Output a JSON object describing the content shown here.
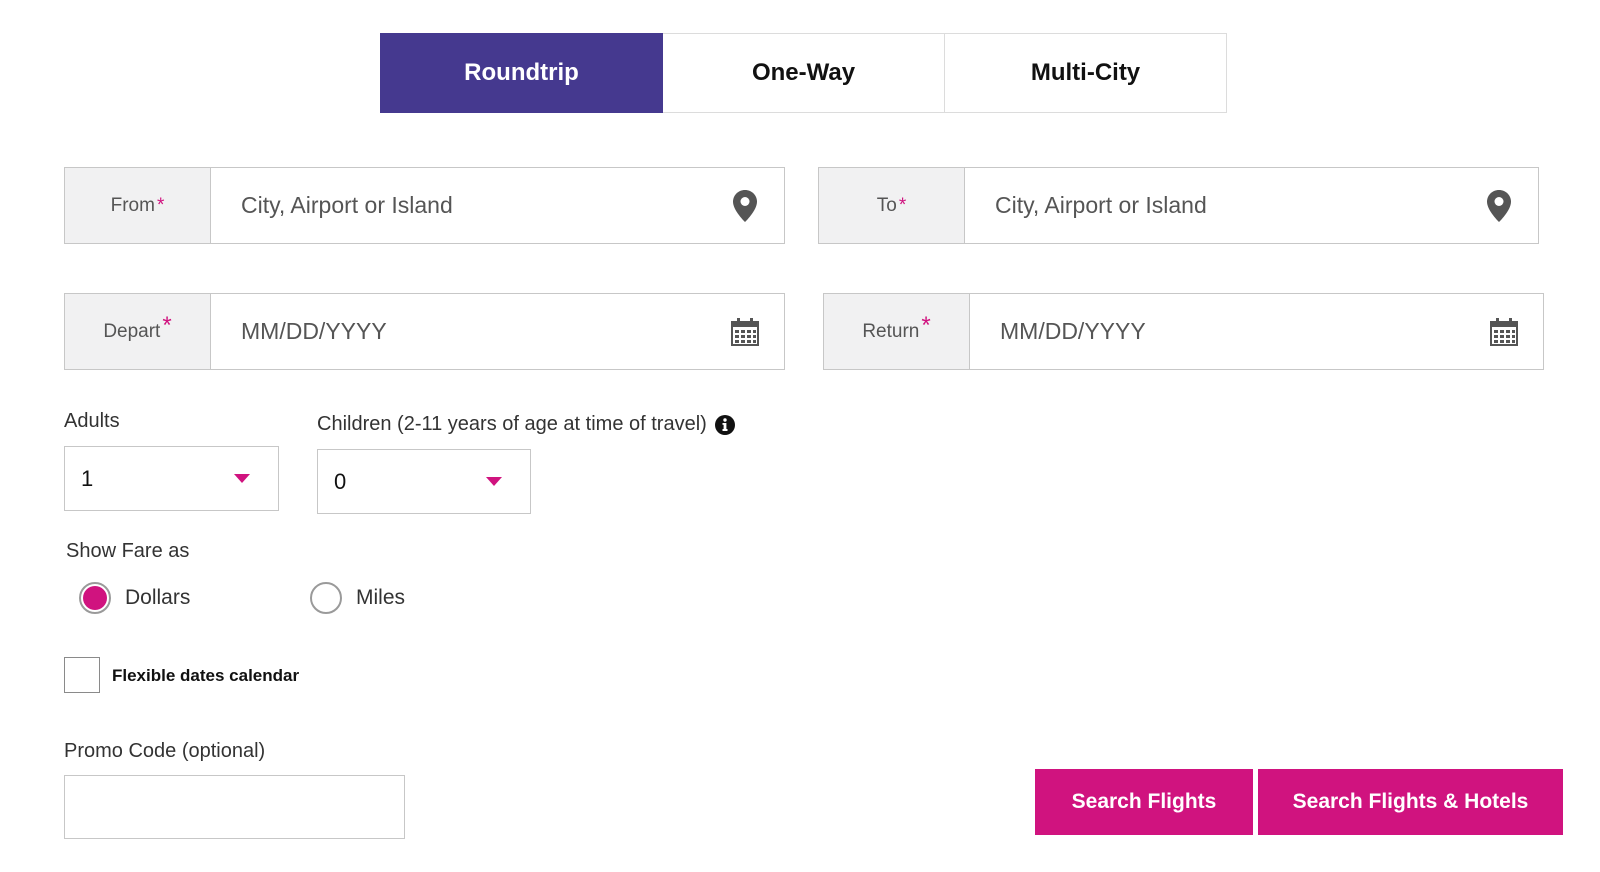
{
  "trip_types": [
    {
      "label": "Roundtrip",
      "active": true
    },
    {
      "label": "One-Way",
      "active": false
    },
    {
      "label": "Multi-City",
      "active": false
    }
  ],
  "from": {
    "label": "From",
    "required_mark": "*",
    "placeholder": "City, Airport or Island",
    "icon": "map-pin-icon"
  },
  "to": {
    "label": "To",
    "required_mark": "*",
    "placeholder": "City, Airport or Island",
    "icon": "map-pin-icon"
  },
  "depart": {
    "label": "Depart",
    "required_mark": "*",
    "placeholder": "MM/DD/YYYY",
    "icon": "calendar-icon"
  },
  "return": {
    "label": "Return",
    "required_mark": "*",
    "placeholder": "MM/DD/YYYY",
    "icon": "calendar-icon"
  },
  "adults": {
    "label": "Adults",
    "value": "1"
  },
  "children": {
    "label": "Children (2-11 years of age at time of travel)",
    "value": "0",
    "icon": "info-icon"
  },
  "fare": {
    "label": "Show Fare as",
    "options": [
      {
        "label": "Dollars",
        "selected": true
      },
      {
        "label": "Miles",
        "selected": false
      }
    ]
  },
  "flexible_dates": {
    "label": "Flexible dates calendar",
    "checked": false
  },
  "promo": {
    "label": "Promo Code (optional)",
    "value": ""
  },
  "buttons": {
    "search_flights": "Search Flights",
    "search_flights_hotels": "Search Flights & Hotels"
  },
  "colors": {
    "primary_purple": "#45398f",
    "accent_magenta": "#d0137f"
  }
}
